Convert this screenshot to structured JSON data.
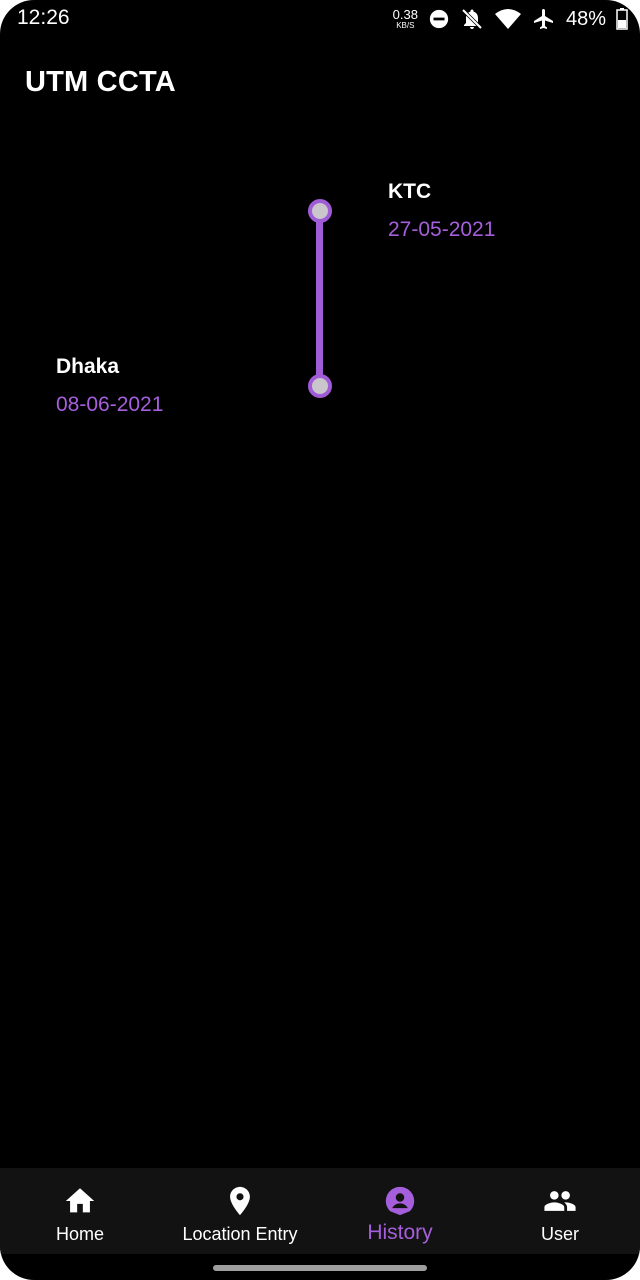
{
  "status_bar": {
    "time": "12:26",
    "net_speed_value": "0.38",
    "net_speed_unit": "KB/S",
    "battery_percent": "48%",
    "icons": [
      "dnd-icon",
      "notifications-off-icon",
      "wifi-icon",
      "airplane-mode-icon",
      "battery-icon"
    ]
  },
  "app_bar": {
    "title": "UTM CCTA"
  },
  "timeline": {
    "accent_color": "#a05bd6",
    "entries": [
      {
        "place": "KTC",
        "date": "27-05-2021"
      },
      {
        "place": "Dhaka",
        "date": "08-06-2021"
      }
    ]
  },
  "bottom_nav": {
    "active_index": 2,
    "active_color": "#a65fdc",
    "items": [
      {
        "label": "Home",
        "icon": "home-icon"
      },
      {
        "label": "Location Entry",
        "icon": "location-pin-icon"
      },
      {
        "label": "History",
        "icon": "account-location-icon"
      },
      {
        "label": "User",
        "icon": "group-icon"
      }
    ]
  }
}
